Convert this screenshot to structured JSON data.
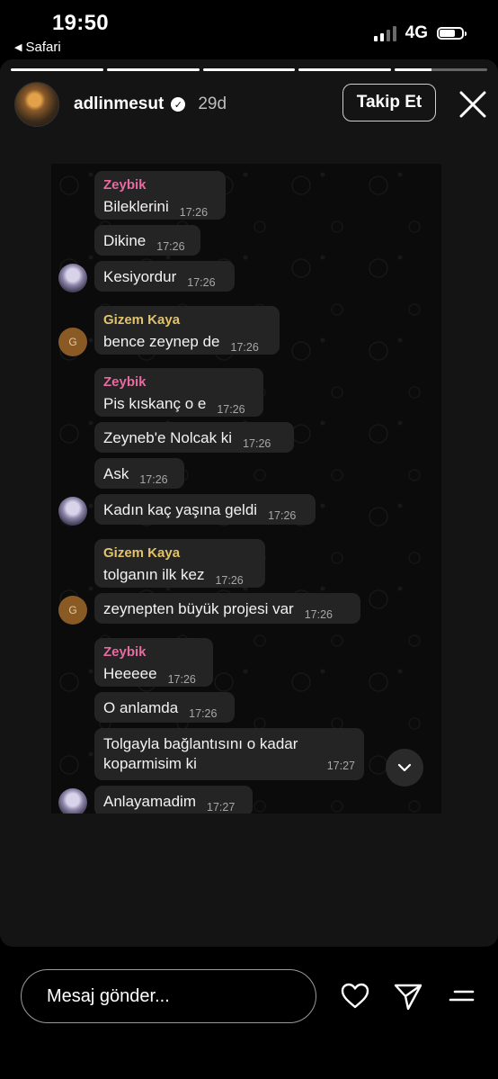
{
  "status_bar": {
    "time": "19:50",
    "back_app": "Safari",
    "network": "4G",
    "battery_level": 0.7
  },
  "story": {
    "progress_segments": [
      1,
      1,
      1,
      1,
      0.4
    ],
    "username": "adlinmesut",
    "age": "29d",
    "follow_label": "Takip Et"
  },
  "chat": {
    "messages": [
      {
        "sender": "Zeybik",
        "sender_color": "#e86aa0",
        "text": "Bileklerini",
        "time": "17:26"
      },
      {
        "text": "Dikine",
        "time": "17:26"
      },
      {
        "text": "Kesiyordur",
        "time": "17:26"
      },
      {
        "sender": "Gizem Kaya",
        "sender_color": "#e2c26b",
        "text": "bence zeynep de",
        "time": "17:26"
      },
      {
        "sender": "Zeybik",
        "sender_color": "#e86aa0",
        "text": "Pis kıskanç o e",
        "time": "17:26"
      },
      {
        "text": "Zeyneb'e Nolcak ki",
        "time": "17:26"
      },
      {
        "text": "Ask",
        "time": "17:26"
      },
      {
        "text": "Kadın kaç yaşına geldi",
        "time": "17:26"
      },
      {
        "sender": "Gizem Kaya",
        "sender_color": "#e2c26b",
        "text": "tolganın ilk kez",
        "time": "17:26"
      },
      {
        "text": "zeynepten büyük projesi var",
        "time": "17:26"
      },
      {
        "sender": "Zeybik",
        "sender_color": "#e86aa0",
        "text": "Heeeee",
        "time": "17:26"
      },
      {
        "text": "O anlamda",
        "time": "17:26"
      },
      {
        "text": "Tolgayla bağlantısını o kadar koparmisim ki",
        "time": "17:27"
      },
      {
        "text": "Anlayamadim",
        "time": "17:27"
      }
    ],
    "avatar_g_letter": "G"
  },
  "bottom_bar": {
    "message_placeholder": "Mesaj gönder..."
  },
  "icons": [
    "back-triangle-icon",
    "signal-icon",
    "battery-icon",
    "verified-icon",
    "close-icon",
    "chevron-down-icon",
    "heart-icon",
    "send-icon",
    "menu-icon"
  ]
}
